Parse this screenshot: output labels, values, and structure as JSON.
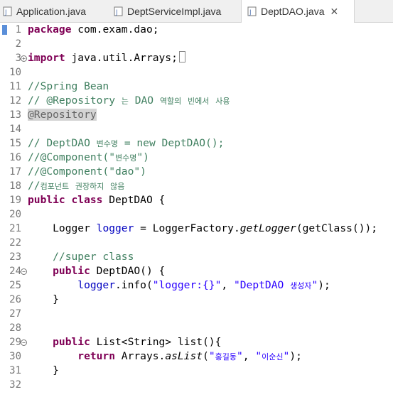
{
  "tabs": [
    {
      "label": "Application.java",
      "active": false
    },
    {
      "label": "DeptServiceImpl.java",
      "active": false
    },
    {
      "label": "DeptDAO.java",
      "active": true
    }
  ],
  "close_glyph": "✕",
  "lines": [
    {
      "n": "1",
      "t": [
        [
          "kw",
          "package"
        ],
        [
          "",
          "com.exam.dao;"
        ]
      ]
    },
    {
      "n": "2",
      "t": []
    },
    {
      "n": "3",
      "t": [
        [
          "kw",
          "import"
        ],
        [
          "",
          "java.util.Arrays;"
        ]
      ]
    },
    {
      "n": "10",
      "t": []
    },
    {
      "n": "11",
      "t": [
        [
          "cm",
          "//Spring Bean"
        ]
      ]
    },
    {
      "n": "12",
      "t": [
        [
          "cm",
          "// @Repository 는 DAO 역할의 빈에서 사용"
        ]
      ]
    },
    {
      "n": "13",
      "t": [
        [
          "ann",
          "@Repository"
        ]
      ]
    },
    {
      "n": "14",
      "t": []
    },
    {
      "n": "15",
      "t": [
        [
          "cm",
          "// DeptDAO 변수명 = new DeptDAO();"
        ]
      ]
    },
    {
      "n": "16",
      "t": [
        [
          "cm",
          "//@Component(\"변수명\")"
        ]
      ]
    },
    {
      "n": "17",
      "t": [
        [
          "cm",
          "//@Component(\"dao\")"
        ]
      ]
    },
    {
      "n": "18",
      "t": [
        [
          "cm",
          "//컴포넌트 권장하지 않음"
        ]
      ]
    },
    {
      "n": "19",
      "t": [
        [
          "kw",
          "public"
        ],
        [
          "kw",
          "class"
        ],
        [
          "",
          "DeptDAO {"
        ]
      ]
    },
    {
      "n": "20",
      "t": []
    },
    {
      "n": "21",
      "t": [
        [
          "",
          "    Logger"
        ],
        [
          "fld",
          "logger"
        ],
        [
          "",
          "= LoggerFactory."
        ],
        [
          "it",
          "getLogger"
        ],
        [
          "",
          "(getClass());"
        ]
      ]
    },
    {
      "n": "22",
      "t": []
    },
    {
      "n": "23",
      "t": [
        [
          "cm",
          "    //super class"
        ]
      ]
    },
    {
      "n": "24",
      "t": [
        [
          "kw",
          "    public"
        ],
        [
          "",
          "DeptDAO() {"
        ]
      ]
    },
    {
      "n": "25",
      "t": [
        [
          "fld",
          "        logger"
        ],
        [
          "",
          ".info("
        ],
        [
          "st",
          "\"logger:{}\""
        ],
        [
          "",
          ","
        ],
        [
          "st",
          "\"DeptDAO 생성자\""
        ],
        [
          "",
          ");"
        ]
      ]
    },
    {
      "n": "26",
      "t": [
        [
          "",
          "    }"
        ]
      ]
    },
    {
      "n": "27",
      "t": []
    },
    {
      "n": "28",
      "t": []
    },
    {
      "n": "29",
      "t": [
        [
          "kw",
          "    public"
        ],
        [
          "",
          "List<String> list(){"
        ]
      ]
    },
    {
      "n": "30",
      "t": [
        [
          "kw",
          "        return"
        ],
        [
          "",
          "Arrays."
        ],
        [
          "it",
          "asList"
        ],
        [
          "",
          "("
        ],
        [
          "st",
          "\"홍길동\""
        ],
        [
          "",
          ","
        ],
        [
          "st",
          "\"이순신\""
        ],
        [
          "",
          ");"
        ]
      ]
    },
    {
      "n": "31",
      "t": [
        [
          "",
          "    }"
        ]
      ]
    },
    {
      "n": "32",
      "t": []
    }
  ]
}
